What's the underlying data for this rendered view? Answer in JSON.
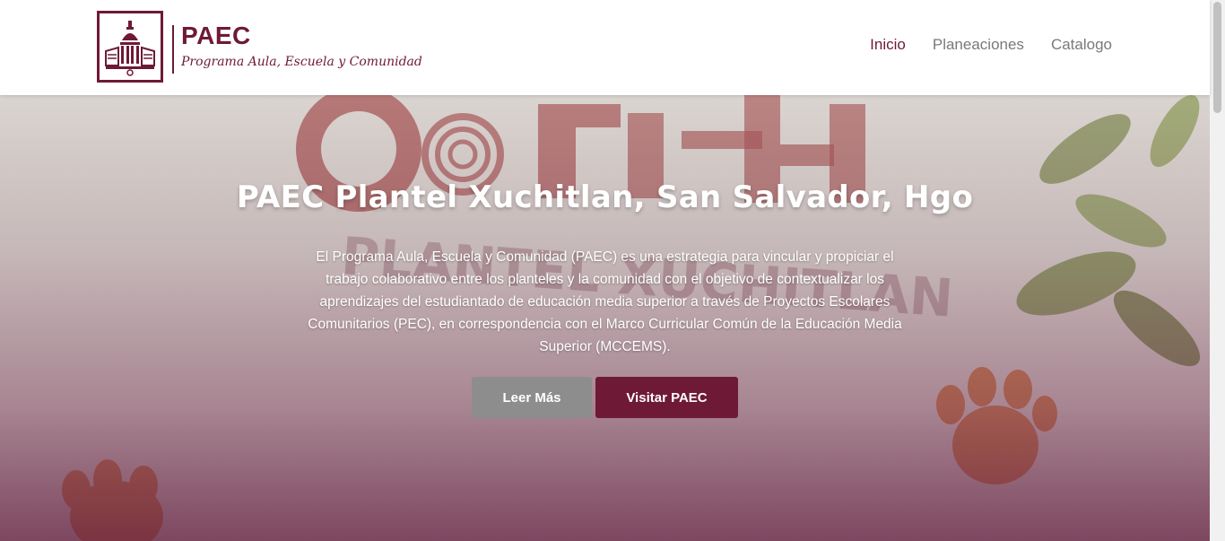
{
  "brand": {
    "title": "PAEC",
    "subtitle": "Programa Aula, Escuela y Comunidad",
    "logo_icon": "school-building-icon",
    "color": "#6e1a37"
  },
  "nav": {
    "items": [
      {
        "label": "Inicio",
        "active": true
      },
      {
        "label": "Planeaciones",
        "active": false
      },
      {
        "label": "Catalogo",
        "active": false
      }
    ]
  },
  "hero": {
    "title": "PAEC Plantel Xuchitlan, San Salvador, Hgo",
    "description": "El Programa Aula, Escuela y Comunidad (PAEC) es una estrategia para vincular y propiciar el trabajo colaborativo entre los planteles y la comunidad con el objetivo de contextualizar los aprendizajes del estudiantado de educación media superior a través de Proyectos Escolares Comunitarios (PEC), en correspondencia con el Marco Curricular Común de la Educación Media Superior (MCCEMS).",
    "buttons": {
      "more_label": "Leer Más",
      "visit_label": "Visitar PAEC"
    },
    "colors": {
      "accent": "#6e1a37",
      "secondary_button": "#8d8d8d"
    }
  }
}
